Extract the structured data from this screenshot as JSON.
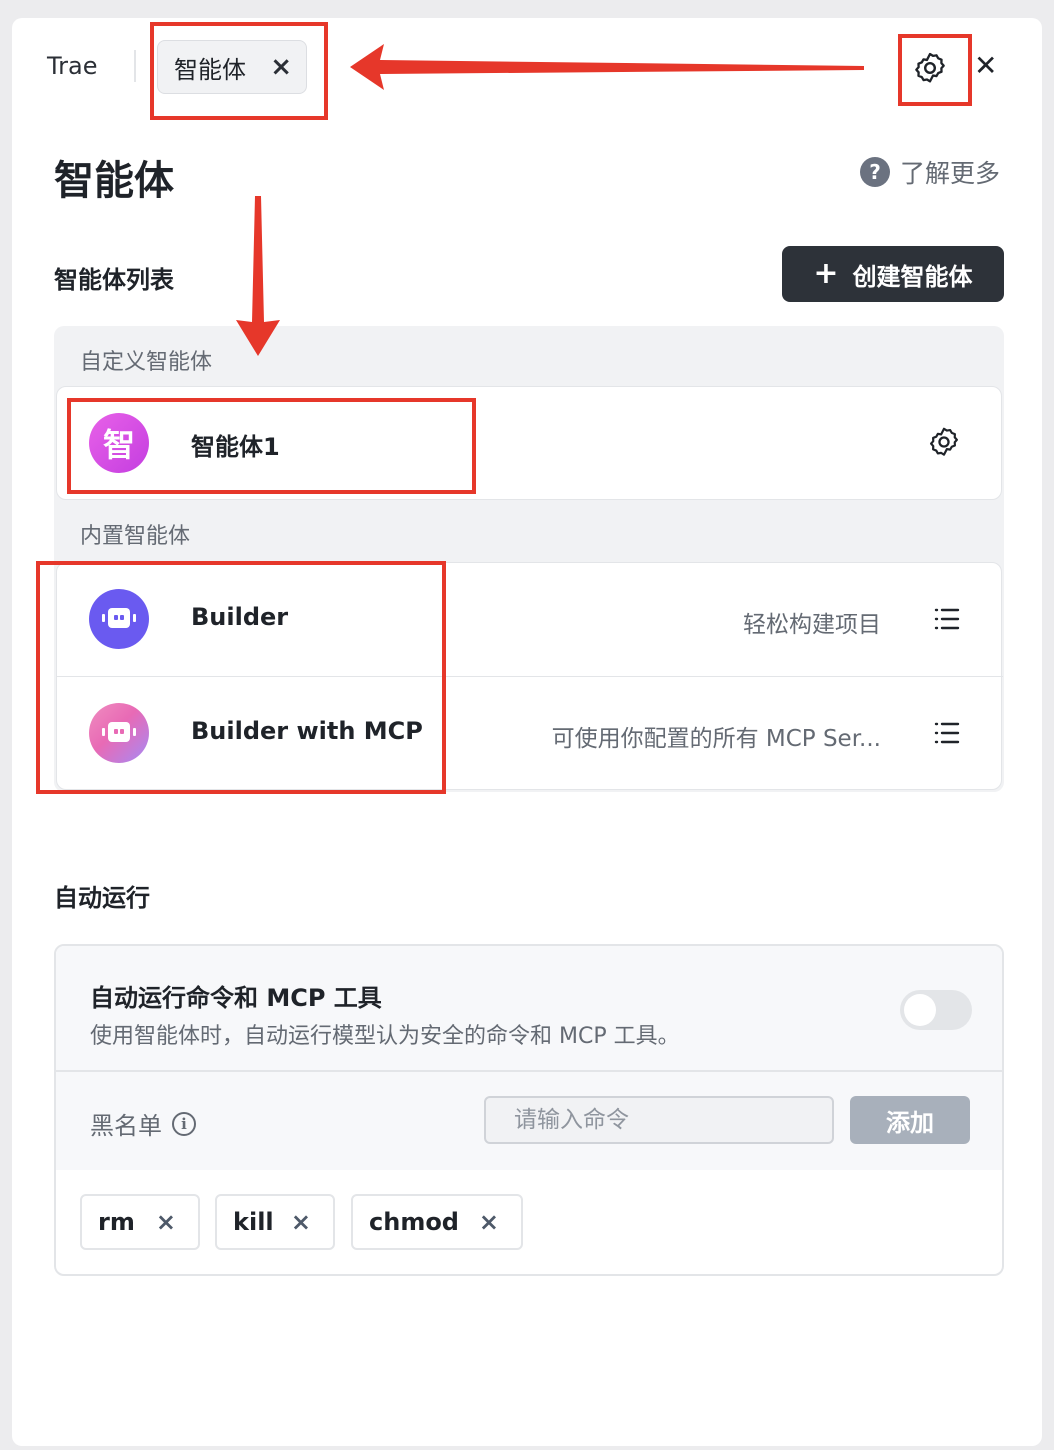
{
  "header": {
    "app_name": "Trae",
    "tab_label": "智能体",
    "tab_close_icon": "close-icon",
    "settings_icon": "gear-icon",
    "close_icon": "close-icon"
  },
  "page": {
    "title": "智能体",
    "learn_more": "了解更多",
    "help_icon_glyph": "?"
  },
  "agents": {
    "section_title": "智能体列表",
    "create_button_plus": "+",
    "create_button_label": "创建智能体",
    "custom_group_label": "自定义智能体",
    "custom": [
      {
        "avatar_text": "智",
        "name": "智能体1",
        "action_icon": "gear-icon"
      }
    ],
    "builtin_group_label": "内置智能体",
    "builtin": [
      {
        "name": "Builder",
        "description": "轻松构建项目",
        "action_icon": "list-icon"
      },
      {
        "name": "Builder with MCP",
        "description": "可使用你配置的所有 MCP Ser...",
        "action_icon": "list-icon"
      }
    ]
  },
  "auto_run": {
    "section_title": "自动运行",
    "title": "自动运行命令和 MCP 工具",
    "subtitle": "使用智能体时，自动运行模型认为安全的命令和 MCP 工具。",
    "toggle_enabled": false,
    "blacklist_label": "黑名单",
    "info_icon_glyph": "i",
    "input_placeholder": "请输入命令",
    "input_value": "",
    "add_button": "添加",
    "chips": [
      {
        "label": "rm",
        "remove": "×"
      },
      {
        "label": "kill",
        "remove": "×"
      },
      {
        "label": "chmod",
        "remove": "×"
      }
    ]
  },
  "colors": {
    "accent_dark": "#2d3239",
    "annotation_red": "#e6372a",
    "builder_purple": "#6a5af0",
    "custom_magenta": "#d94fe4"
  }
}
